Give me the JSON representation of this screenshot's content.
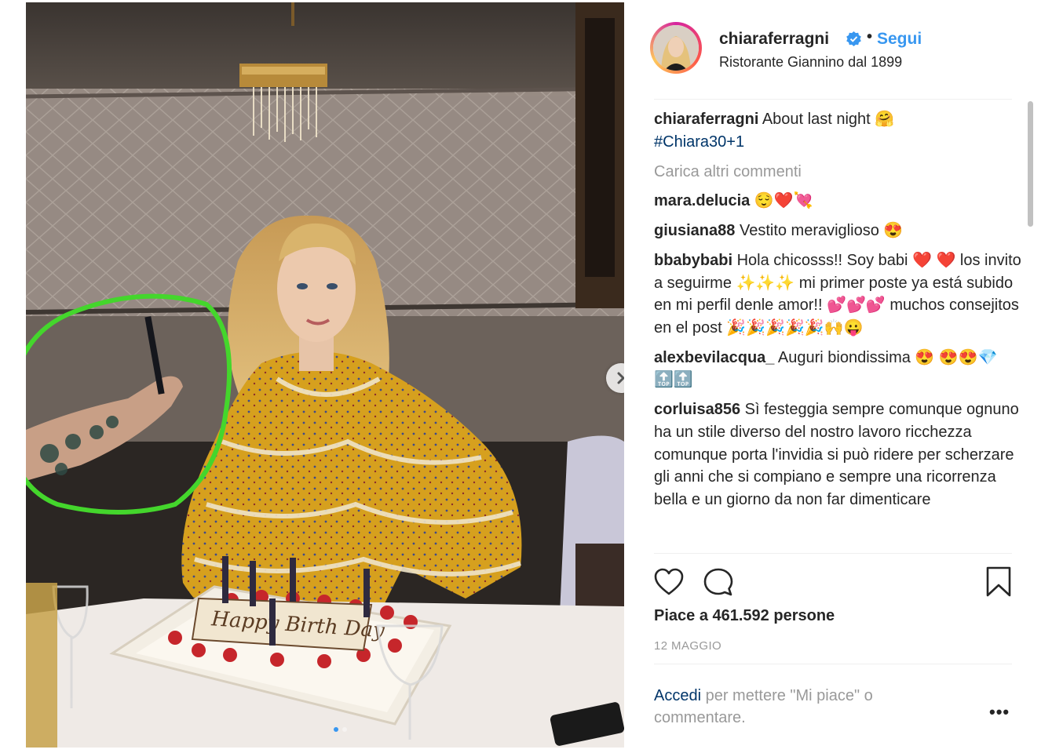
{
  "post": {
    "username": "chiaraferragni",
    "follow_label": "Segui",
    "separator": "•",
    "location": "Ristorante Giannino dal 1899",
    "cake_text": "Happy Birth Day"
  },
  "caption": {
    "username": "chiaraferragni",
    "text": "About last night",
    "emoji": "🤗",
    "hashtag": "#Chiara30+1"
  },
  "load_more_label": "Carica altri commenti",
  "comments": [
    {
      "user": "mara.delucia",
      "text": "😌❤️💘"
    },
    {
      "user": "giusiana88",
      "text": "Vestito meraviglioso 😍"
    },
    {
      "user": "bbabybabi",
      "text": "Hola chicosss!! Soy babi ❤️ ❤️ los invito a seguirme ✨✨✨ mi primer poste ya está subido en mi perfil denle amor!! 💕💕💕 muchos consejitos en el post 🎉🎉🎉🎉🎉🙌😛"
    },
    {
      "user": "alexbevilacqua_",
      "text": "Auguri biondissima 😍 😍😍💎🔝🔝"
    },
    {
      "user": "corluisa856",
      "text": "Sì festeggia sempre comunque ognuno ha un stile diverso del nostro lavoro ricchezza comunque porta l'invidia si può ridere per scherzare gli anni che si compiano e sempre una ricorrenza bella e un giorno da non far dimenticare"
    }
  ],
  "likes_label": "Piace a 461.592 persone",
  "date_label": "12 MAGGIO",
  "login_prompt": {
    "link": "Accedi",
    "text": " per mettere \"Mi piace\" o commentare."
  },
  "more_label": "•••",
  "icons": {
    "like": "heart-icon",
    "comment": "comment-icon",
    "save": "bookmark-icon",
    "verified": "verified-badge-icon",
    "next": "chevron-right-icon"
  },
  "colors": {
    "link_blue": "#3897f0",
    "hashtag_blue": "#003569",
    "muted_gray": "#999999",
    "highlight_green": "#44d62c",
    "dress_yellow": "#d9a21f"
  },
  "carousel": {
    "count": 2,
    "active_index": 0
  }
}
